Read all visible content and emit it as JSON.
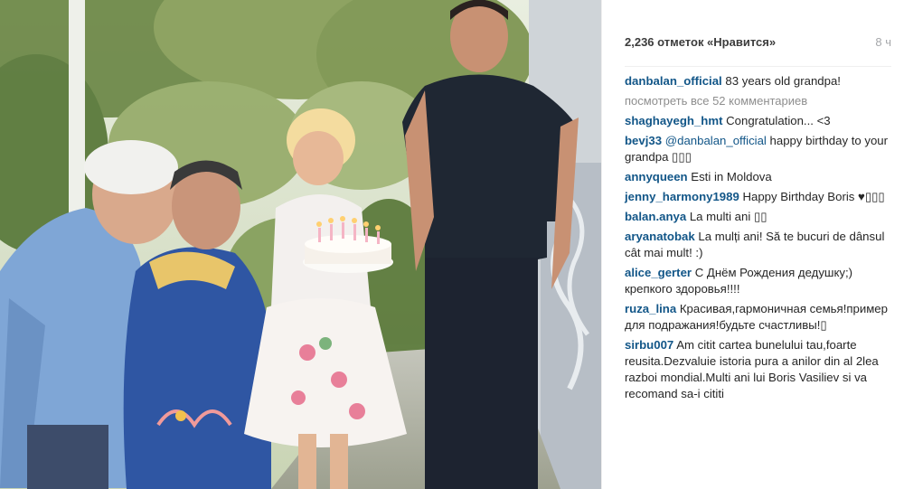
{
  "photo": {
    "alt_subject": ""
  },
  "header": {
    "likes": "2,236 отметок «Нравится»",
    "time": "8 ч"
  },
  "caption": {
    "user": "danbalan_official",
    "text": "83 years old grandpa!"
  },
  "view_all": "посмотреть все 52 комментариев",
  "comments": [
    {
      "user": "shaghayegh_hmt",
      "text": "Congratulation... <3"
    },
    {
      "user": "bevj33",
      "mention": "@danbalan_official",
      "text": "happy birthday to your grandpa ▯▯▯"
    },
    {
      "user": "annyqueen",
      "text": "Esti in Moldova"
    },
    {
      "user": "jenny_harmony1989",
      "text": "Happy Birthday Boris ♥▯▯▯"
    },
    {
      "user": "balan.anya",
      "text": "La multi ani ▯▯"
    },
    {
      "user": "aryanatobak",
      "text": "La mulți ani! Să te bucuri de dânsul cât mai mult! :)"
    },
    {
      "user": "alice_gerter",
      "text": "С Днём Рождения дедушку;) крепкого здоровья!!!!"
    },
    {
      "user": "ruza_lina",
      "text": "Красивая,гармоничная семья!пример для подражания!будьте счастливы!▯"
    },
    {
      "user": "sirbu007",
      "text": "Am citit cartea bunelului tau,foarte reusita.Dezvaluie istoria pura a anilor din al 2lea razboi mondial.Multi ani lui Boris Vasiliev si va recomand sa-i cititi"
    }
  ],
  "colors": {
    "username": "#125688",
    "text": "#262626",
    "muted": "#8e8e8e",
    "foliage": "#6f8a4a"
  }
}
